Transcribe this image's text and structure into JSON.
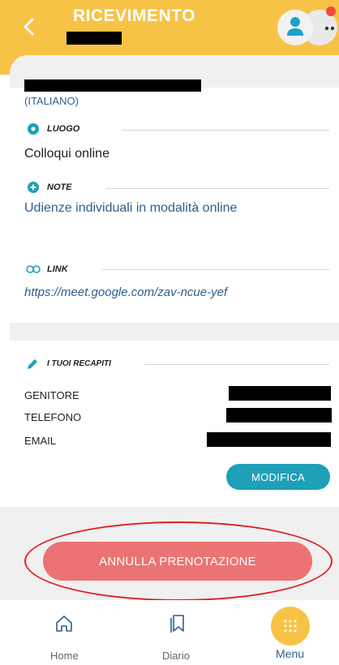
{
  "header": {
    "title": "RICEVIMENTO"
  },
  "details": {
    "language": "(ITALIANO)",
    "luogo_label": "LUOGO",
    "luogo_value": "Colloqui online",
    "note_label": "NOTE",
    "note_value": "Udienze individuali in modalità online",
    "link_label": "LINK",
    "link_value": "https://meet.google.com/zav-ncue-yef"
  },
  "contacts": {
    "section_label": "I TUOI RECAPITI",
    "rows": [
      {
        "label": "GENITORE"
      },
      {
        "label": "TELEFONO"
      },
      {
        "label": "EMAIL"
      }
    ],
    "edit_button": "MODIFICA"
  },
  "actions": {
    "cancel_button": "ANNULLA PRENOTAZIONE"
  },
  "bottom_nav": {
    "items": [
      {
        "label": "Home",
        "icon": "home-icon"
      },
      {
        "label": "Diario",
        "icon": "bookmark-icon"
      },
      {
        "label": "Menu",
        "icon": "grid-dots-icon"
      }
    ]
  },
  "colors": {
    "header": "#f7c347",
    "primary_text": "#2f5d8a",
    "edit_button": "#1ea0b8",
    "cancel_button": "#ec7373",
    "annotation": "#e02020"
  }
}
